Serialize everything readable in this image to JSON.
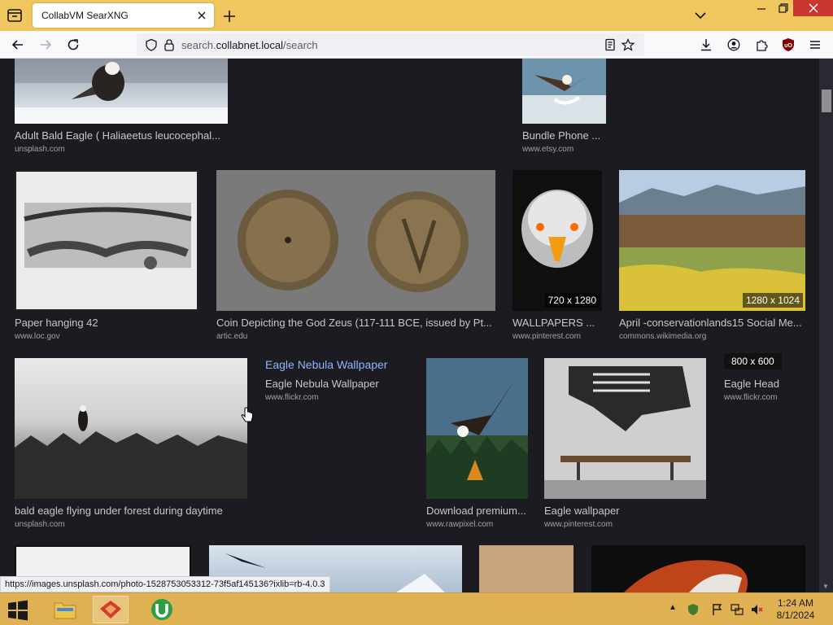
{
  "browser": {
    "tab_title": "CollabVM SearXNG",
    "url_prefix": "search.",
    "url_host": "collabnet.local",
    "url_path": "/search"
  },
  "results": {
    "row1": [
      {
        "caption": "Adult Bald Eagle ( Haliaeetus leucocephal...",
        "source": "unsplash.com"
      },
      {
        "caption": "Bundle Phone ...",
        "source": "www.etsy.com"
      }
    ],
    "row2": [
      {
        "caption": "Paper hanging 42",
        "source": "www.loc.gov"
      },
      {
        "caption": "Coin Depicting the God Zeus (117-111 BCE, issued by Pt...",
        "source": "artic.edu"
      },
      {
        "caption": "WALLPAPERS ...",
        "source": "www.pinterest.com",
        "resolution": "720 x 1280"
      },
      {
        "caption": "April -conservationlands15 Social Me...",
        "source": "commons.wikimedia.org",
        "resolution": "1280 x 1024"
      }
    ],
    "row3": [
      {
        "caption": "bald eagle flying under forest during daytime",
        "source": "unsplash.com"
      },
      {
        "title": "Eagle Nebula Wallpaper",
        "caption": "Eagle Nebula Wallpaper",
        "source": "www.flickr.com"
      },
      {
        "caption": "Download premium...",
        "source": "www.rawpixel.com"
      },
      {
        "caption": "Eagle wallpaper",
        "source": "www.pinterest.com"
      },
      {
        "caption": "Eagle Head",
        "source": "www.flickr.com",
        "resolution": "800 x 600",
        "title_partial": "Eagle Head"
      }
    ]
  },
  "status_bar_url": "https://images.unsplash.com/photo-1528753053312-73f5af145136?ixlib=rb-4.0.3",
  "taskbar": {
    "time": "1:24 AM",
    "date": "8/1/2024"
  },
  "colors": {
    "tabbar": "#f0c75e",
    "page_bg": "#1c1b22",
    "link": "#8fb4ff",
    "close_button": "#c7372f",
    "taskbar": "#e0b152"
  }
}
